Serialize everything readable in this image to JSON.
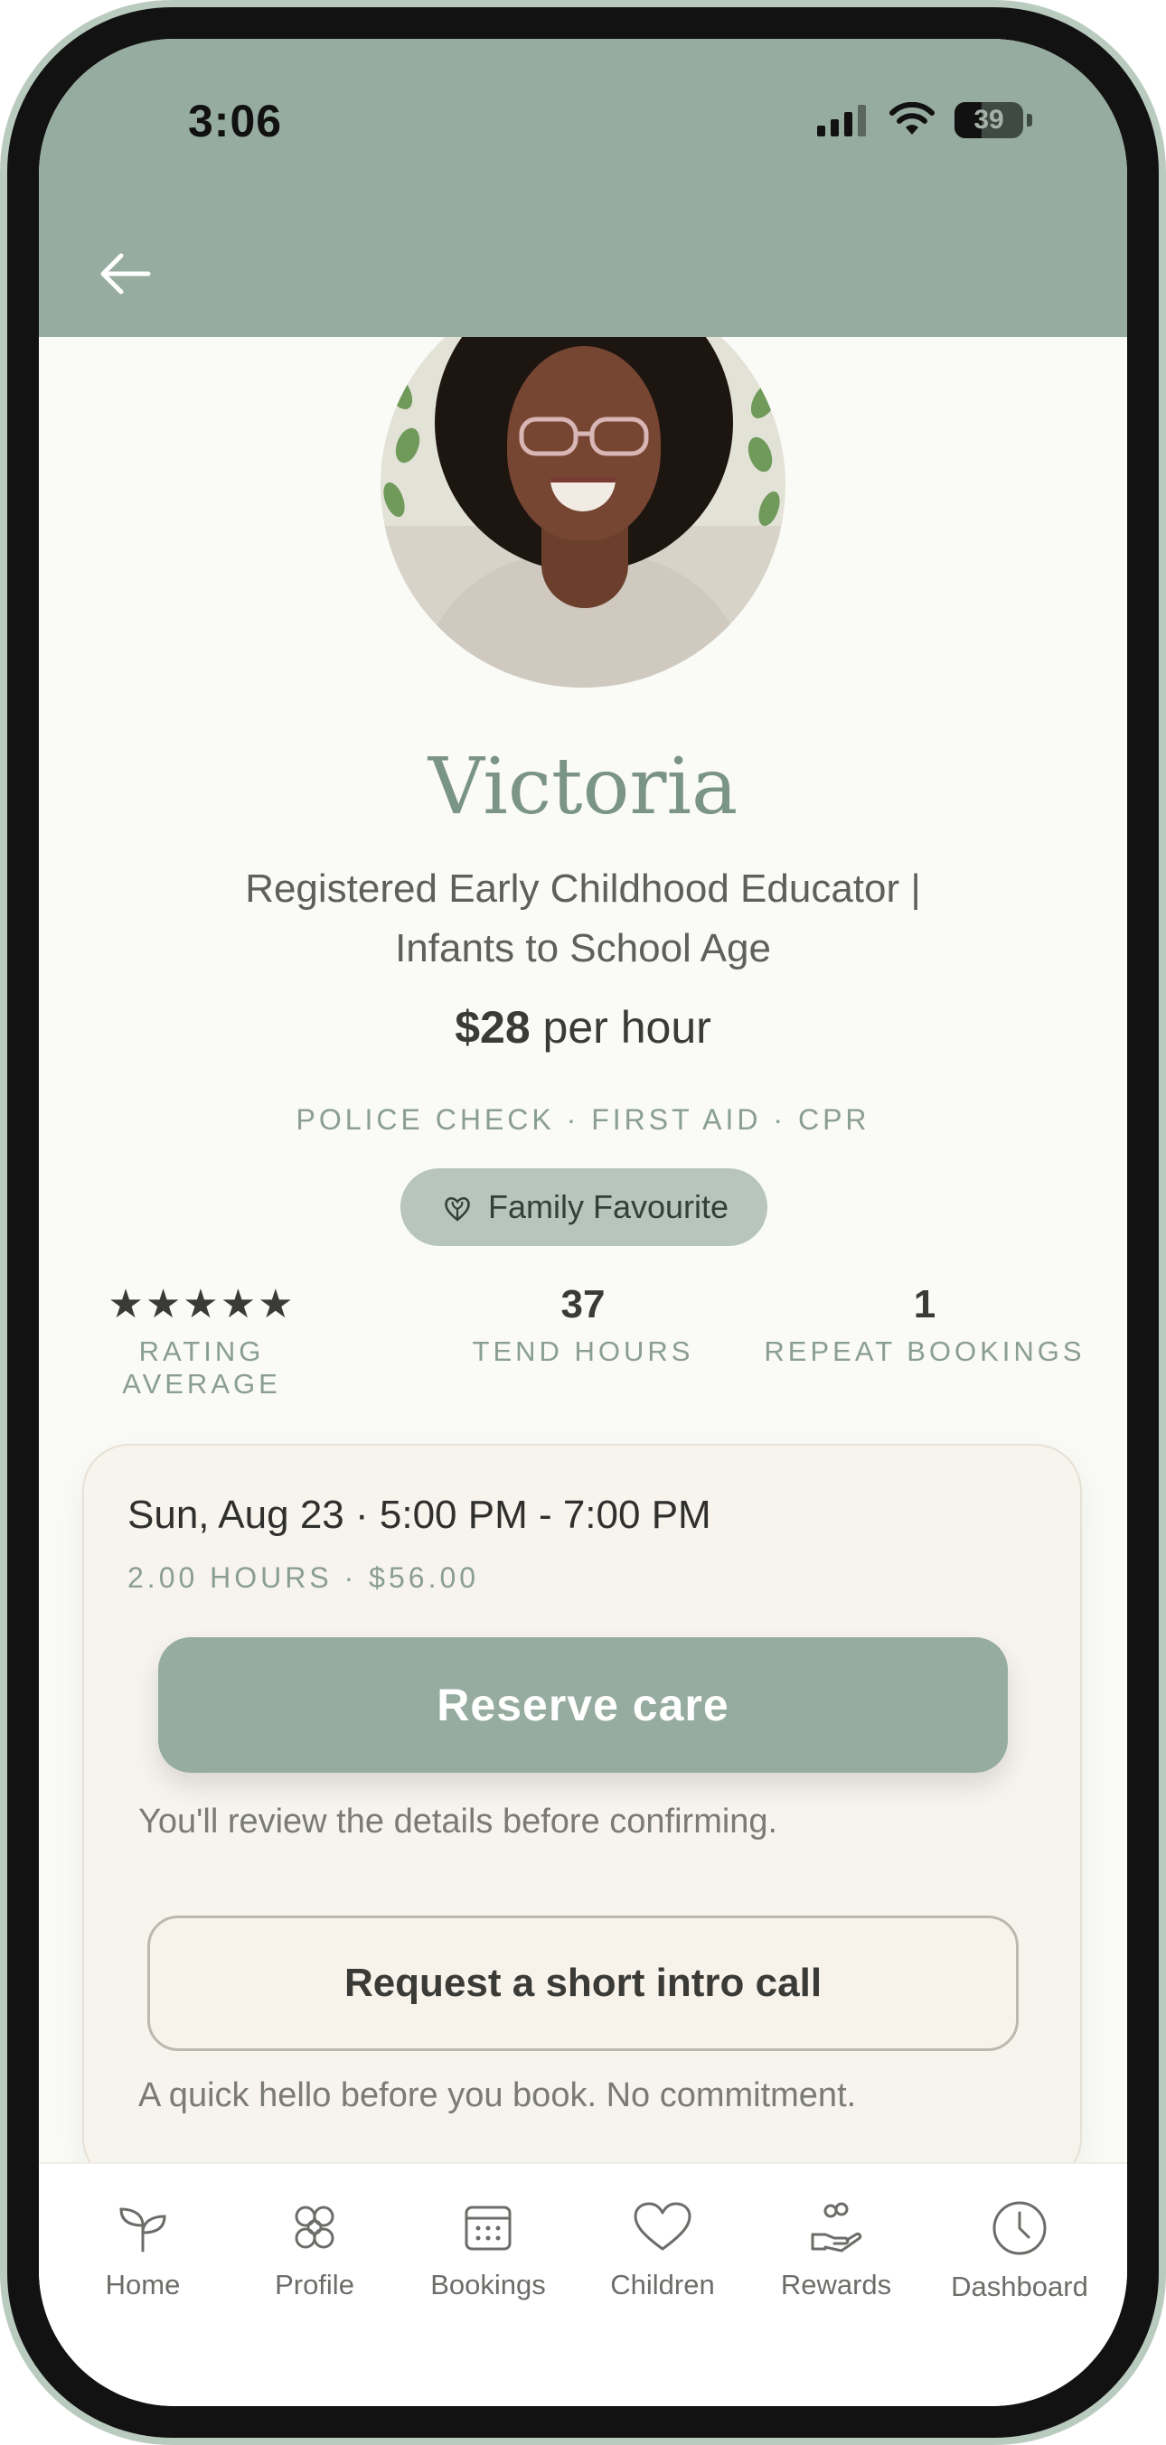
{
  "status_bar": {
    "time": "3:06",
    "battery": "39"
  },
  "profile": {
    "name": "Victoria",
    "subtitle_line1": "Registered Early Childhood Educator |",
    "subtitle_line2": "Infants to School Age",
    "rate_amount": "$28",
    "rate_unit": "per hour",
    "certifications": "POLICE CHECK · FIRST AID · CPR",
    "badge": "Family Favourite"
  },
  "stats": [
    {
      "value": "★★★★★",
      "label": "RATING AVERAGE"
    },
    {
      "value": "37",
      "label": "TEND HOURS"
    },
    {
      "value": "1",
      "label": "REPEAT BOOKINGS"
    }
  ],
  "booking": {
    "slot": "Sun, Aug 23 · 5:00 PM - 7:00 PM",
    "meta": "2.00 HOURS · $56.00",
    "reserve_label": "Reserve care",
    "reserve_note": "You'll review the details before confirming.",
    "intro_label": "Request a short intro call",
    "intro_note": "A quick hello before you book. No commitment."
  },
  "tabs": [
    {
      "label": "Home",
      "icon": "sprout-icon"
    },
    {
      "label": "Profile",
      "icon": "flower-icon"
    },
    {
      "label": "Bookings",
      "icon": "calendar-icon"
    },
    {
      "label": "Children",
      "icon": "heart-icon"
    },
    {
      "label": "Rewards",
      "icon": "hand-gift-icon"
    },
    {
      "label": "Dashboard",
      "icon": "clock-icon"
    }
  ],
  "colors": {
    "header": "#97aca0",
    "accent_text": "#7a9485",
    "background": "#fafaf6"
  }
}
